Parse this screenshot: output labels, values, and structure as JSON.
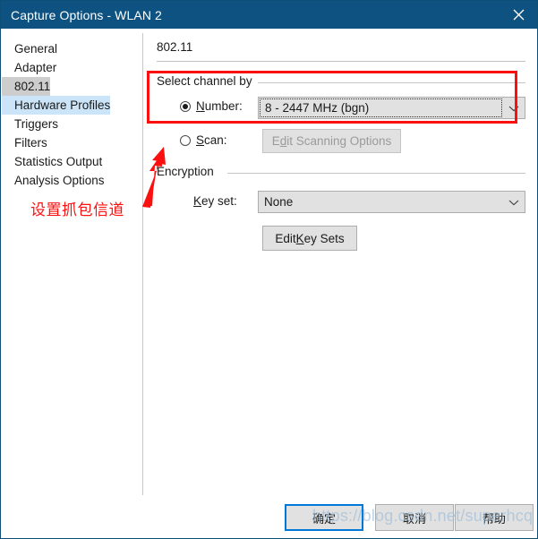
{
  "window": {
    "title": "Capture Options - WLAN 2",
    "close_icon": "close-icon",
    "titlebar_color": "#0e5281"
  },
  "sidebar": {
    "items": [
      {
        "label": "General",
        "state": "normal"
      },
      {
        "label": "Adapter",
        "state": "normal"
      },
      {
        "label": "802.11",
        "state": "selected"
      },
      {
        "label": "Hardware Profiles",
        "state": "hover"
      },
      {
        "label": "Triggers",
        "state": "normal"
      },
      {
        "label": "Filters",
        "state": "normal"
      },
      {
        "label": "Statistics Output",
        "state": "normal"
      },
      {
        "label": "Analysis Options",
        "state": "normal"
      }
    ]
  },
  "content": {
    "page_title": "802.11",
    "channel_group": {
      "label": "Select channel by",
      "number_radio": {
        "label_prefix": "",
        "mnemonic": "N",
        "label_suffix": "umber:",
        "checked": true
      },
      "channel_combo": {
        "value": "8 - 2447 MHz (bgn)",
        "focused": true,
        "arrow_icon": "chevron-down-icon"
      },
      "scan_radio": {
        "label_prefix": "",
        "mnemonic": "S",
        "label_suffix": "can:",
        "checked": false
      },
      "scan_button": {
        "text_before": "E",
        "mnemonic": "d",
        "text_after": "it Scanning Options",
        "enabled": false
      }
    },
    "encryption_group": {
      "label": "Encryption",
      "key_set_label": {
        "mnemonic": "K",
        "text_after": "ey set:"
      },
      "key_set_combo": {
        "value": "None",
        "focused": false,
        "arrow_icon": "chevron-down-icon"
      },
      "edit_key_sets_button": {
        "text_before": "Edit ",
        "mnemonic": "K",
        "text_after": "ey Sets",
        "enabled": true
      }
    }
  },
  "footer": {
    "ok_label": "确定",
    "cancel_label": "取消",
    "help_label": "帮助",
    "focus_color": "#0078d7"
  },
  "annotations": {
    "note_text": "设置抓包信道",
    "highlight_color": "#fc0f0f",
    "watermark": "https://blog.csdn.net/superhcq"
  }
}
